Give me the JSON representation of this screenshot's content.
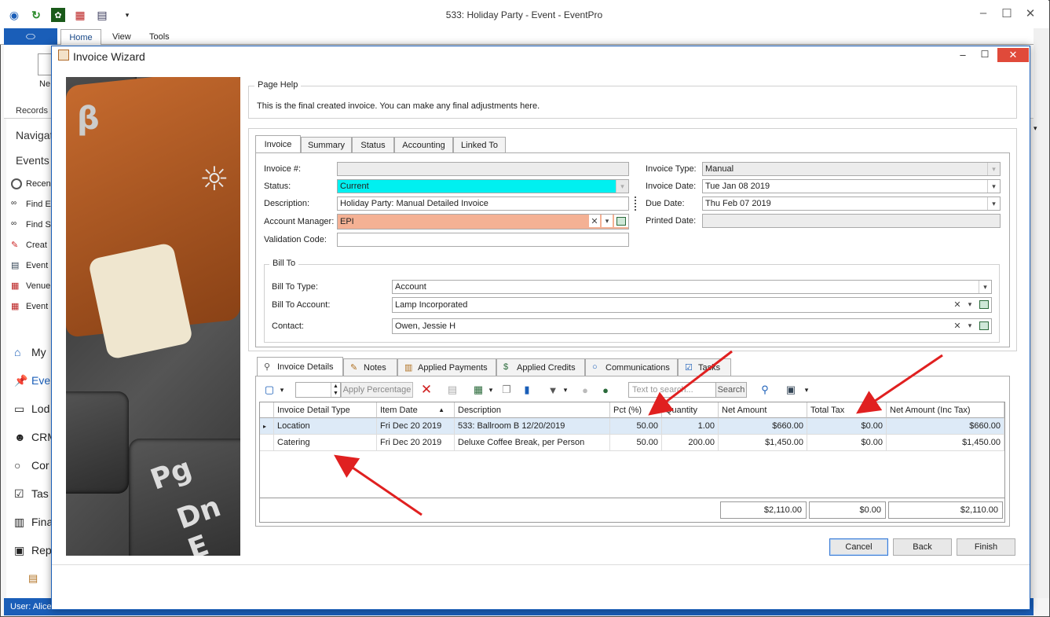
{
  "app": {
    "title": "533: Holiday Party - Event - EventPro",
    "ribbon_tabs": [
      "Home",
      "View",
      "Tools"
    ],
    "new_label": "Ne",
    "records_group": "Records",
    "status_user": "User: Alice"
  },
  "nav": {
    "header1": "Navigat",
    "header2": "Events",
    "items": [
      "Recen",
      "Find E",
      "Find S",
      "Creat",
      "Event",
      "Venue",
      "Event"
    ],
    "large_items": [
      "My",
      "Eve",
      "Lod",
      "CRM",
      "Cor",
      "Tas",
      "Fina",
      "Rep"
    ]
  },
  "dialog": {
    "title": "Invoice Wizard",
    "image_keys": {
      "beta": "β",
      "pg": "Pg",
      "dn": "Dn E"
    }
  },
  "page_help": {
    "caption": "Page Help",
    "text": "This is the final created invoice.  You can make any final adjustments here."
  },
  "main_tabs": [
    "Invoice",
    "Summary",
    "Status",
    "Accounting",
    "Linked To"
  ],
  "invoice": {
    "invoice_no_label": "Invoice #:",
    "invoice_no": "",
    "status_label": "Status:",
    "status": "Current",
    "status_color": "#00f0f0",
    "description_label": "Description:",
    "description": "Holiday Party: Manual Detailed Invoice",
    "account_manager_label": "Account Manager:",
    "account_manager": "EPI",
    "account_manager_color": "#f4b194",
    "validation_label": "Validation Code:",
    "validation": "",
    "invoice_type_label": "Invoice Type:",
    "invoice_type": "Manual",
    "invoice_date_label": "Invoice Date:",
    "invoice_date": "Tue Jan 08 2019",
    "due_date_label": "Due Date:",
    "due_date": "Thu Feb 07 2019",
    "printed_date_label": "Printed Date:",
    "printed_date": ""
  },
  "bill_to": {
    "caption": "Bill To",
    "type_label": "Bill To Type:",
    "type": "Account",
    "account_label": "Bill To Account:",
    "account": "Lamp Incorporated",
    "contact_label": "Contact:",
    "contact": "Owen, Jessie H"
  },
  "lower_tabs": [
    "Invoice Details",
    "Notes",
    "Applied Payments",
    "Applied Credits",
    "Communications",
    "Tasks"
  ],
  "toolbar": {
    "apply_percentage": "Apply Percentage",
    "search_placeholder": "Text to search...",
    "search_button": "Search"
  },
  "grid": {
    "columns": [
      "Invoice Detail Type",
      "Item Date",
      "Description",
      "Pct (%)",
      "Quantity",
      "Net Amount",
      "Total Tax",
      "Net Amount (Inc Tax)"
    ],
    "rows": [
      [
        "Location",
        "Fri Dec 20 2019",
        "533: Ballroom B 12/20/2019",
        "50.00",
        "1.00",
        "$660.00",
        "$0.00",
        "$660.00"
      ],
      [
        "Catering",
        "Fri Dec 20 2019",
        "Deluxe Coffee Break, per Person",
        "50.00",
        "200.00",
        "$1,450.00",
        "$0.00",
        "$1,450.00"
      ]
    ],
    "totals": {
      "net": "$2,110.00",
      "tax": "$0.00",
      "inc_tax": "$2,110.00"
    }
  },
  "buttons": {
    "cancel": "Cancel",
    "back": "Back",
    "finish": "Finish"
  },
  "colors": {
    "accent": "#1a5eb8",
    "arrow": "#e02020",
    "close": "#e04a3a"
  }
}
